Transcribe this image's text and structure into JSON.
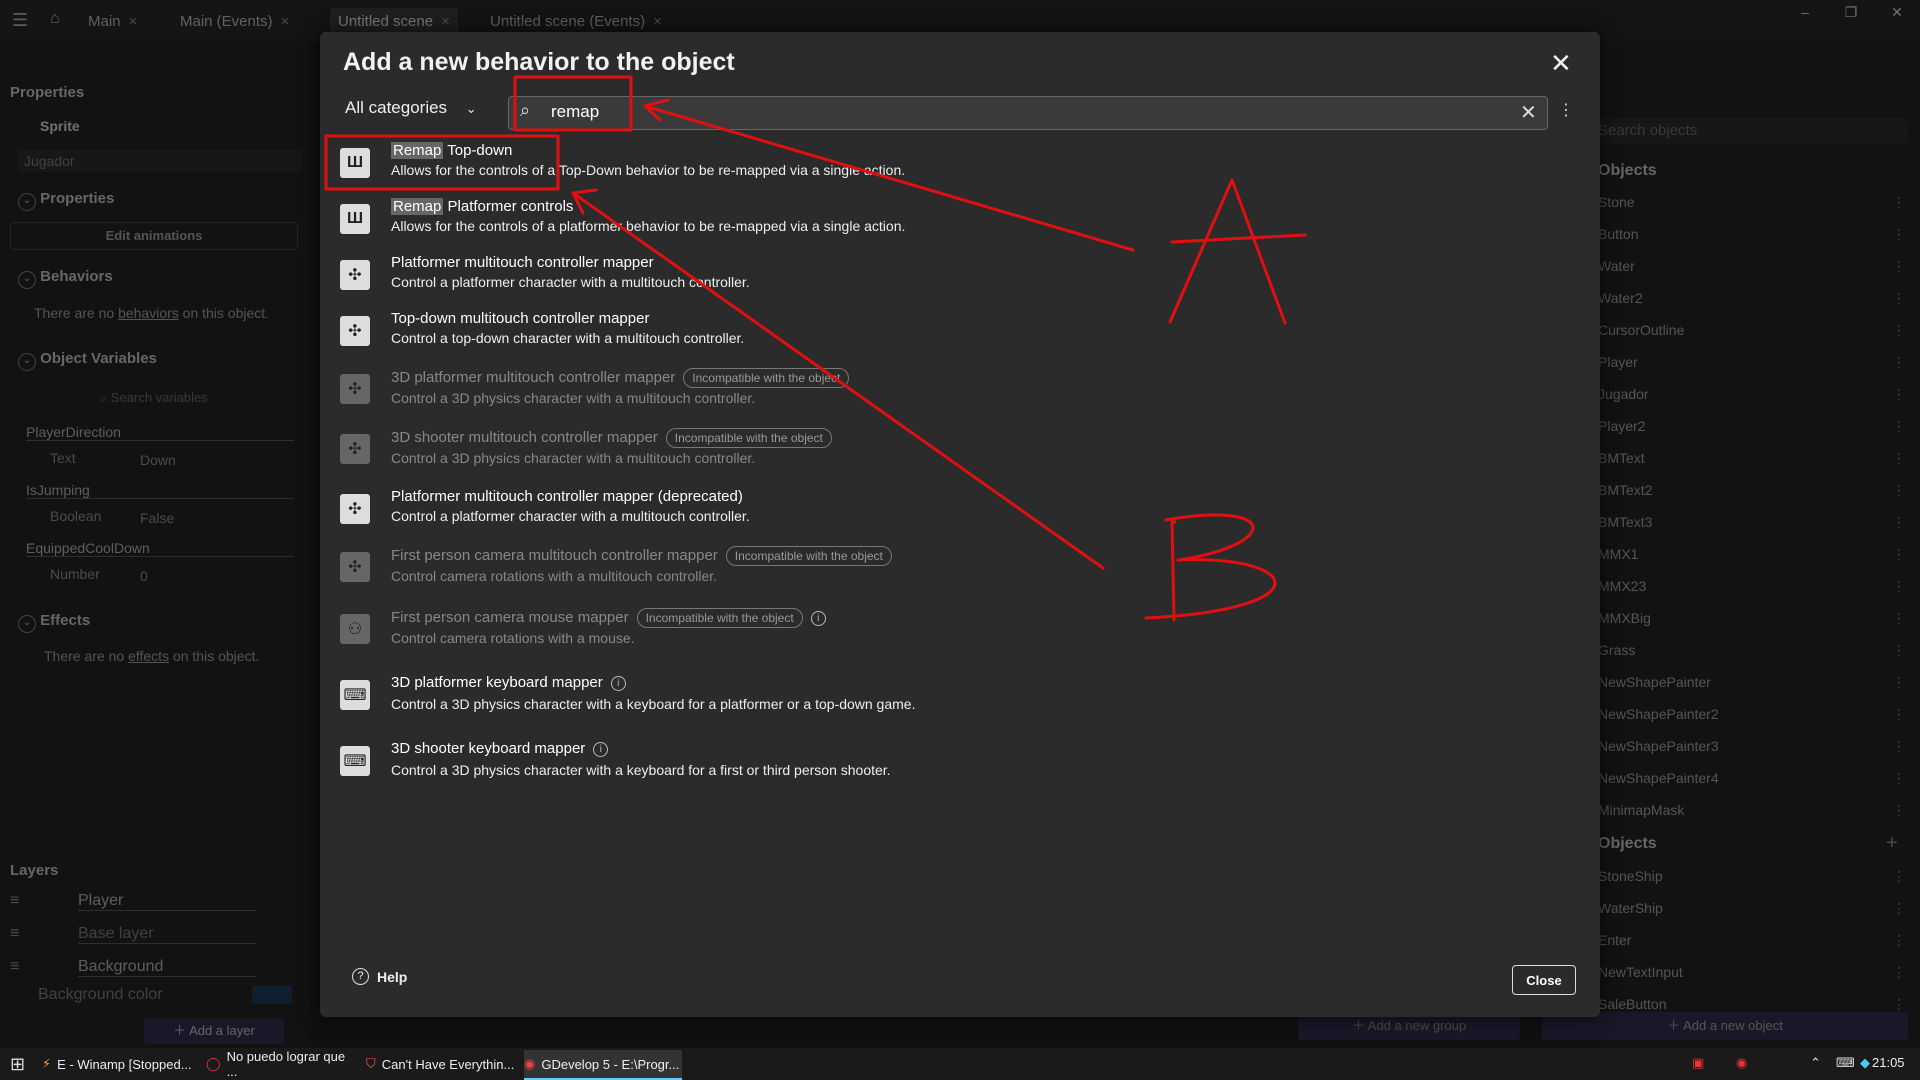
{
  "tabs": [
    {
      "label": "Main"
    },
    {
      "label": "Main (Events)"
    },
    {
      "label": "Untitled scene"
    },
    {
      "label": "Untitled scene (Events)"
    }
  ],
  "left_panel": {
    "properties_title": "Properties",
    "sprite_label": "Sprite",
    "object_name": "Jugador",
    "properties_section": "Properties",
    "edit_animations": "Edit animations",
    "behaviors_section": "Behaviors",
    "behaviors_empty_prefix": "There are no",
    "behaviors_empty_link": "behaviors",
    "behaviors_empty_suffix": "on this object.",
    "variables_section": "Object Variables",
    "search_variables_placeholder": "Search variables",
    "variables": [
      {
        "name": "PlayerDirection",
        "type": "Text",
        "value": "Down"
      },
      {
        "name": "IsJumping",
        "type": "Boolean",
        "value": "False"
      },
      {
        "name": "EquippedCoolDown",
        "type": "Number",
        "value": "0"
      }
    ],
    "effects_section": "Effects",
    "effects_empty_prefix": "There are no",
    "effects_empty_link": "effects",
    "effects_empty_suffix": "on this object.",
    "layers_title": "Layers",
    "layers": [
      {
        "name": "Player"
      },
      {
        "name": "Base layer"
      },
      {
        "name": "Background"
      }
    ],
    "background_color_label": "Background color",
    "add_layer": "Add a layer"
  },
  "right_panel": {
    "search_placeholder": "Search objects",
    "scene_objects_header": "Objects",
    "scene_objects": [
      "Stone",
      "Button",
      "Water",
      "Water2",
      "CursorOutline",
      "Player",
      "Jugador",
      "Player2",
      "BMText",
      "BMText2",
      "BMText3",
      "MMX1",
      "MMX23",
      "MMXBig",
      "Grass",
      "NewShapePainter",
      "NewShapePainter2",
      "NewShapePainter3",
      "NewShapePainter4",
      "MinimapMask"
    ],
    "global_objects_header": "Objects",
    "global_objects": [
      "StoneShip",
      "WaterShip",
      "Enter",
      "NewTextInput",
      "SaleButton"
    ],
    "add_group": "Add a new group",
    "add_object": "Add a new object"
  },
  "dialog": {
    "title": "Add a new behavior to the object",
    "category": "All categories",
    "search_value": "remap",
    "results": [
      {
        "highlight": "Remap",
        "title_rest": " Top-down",
        "desc": "Allows for the controls of a Top-Down behavior to be re-mapped via a single action.",
        "icon": "remap-icon",
        "disabled": false
      },
      {
        "highlight": "Remap",
        "title_rest": " Platformer controls",
        "desc": "Allows for the controls of a platformer behavior to be re-mapped via a single action.",
        "icon": "remap-icon",
        "disabled": false
      },
      {
        "title": "Platformer multitouch controller mapper",
        "desc": "Control a platformer character with a multitouch controller.",
        "icon": "joystick-icon",
        "disabled": false
      },
      {
        "title": "Top-down multitouch controller mapper",
        "desc": "Control a top-down character with a multitouch controller.",
        "icon": "joystick-icon",
        "disabled": false
      },
      {
        "title": "3D platformer multitouch controller mapper",
        "desc": "Control a 3D physics character with a multitouch controller.",
        "icon": "joystick-icon",
        "disabled": true,
        "badge": "Incompatible with the object"
      },
      {
        "title": "3D shooter multitouch controller mapper",
        "desc": "Control a 3D physics character with a multitouch controller.",
        "icon": "joystick-icon",
        "disabled": true,
        "badge": "Incompatible with the object"
      },
      {
        "title": "Platformer multitouch controller mapper (deprecated)",
        "desc": "Control a platformer character with a multitouch controller.",
        "icon": "joystick-icon",
        "disabled": false
      },
      {
        "title": "First person camera multitouch controller mapper",
        "desc": "Control camera rotations with a multitouch controller.",
        "icon": "joystick-icon",
        "disabled": true,
        "badge": "Incompatible with the object"
      },
      {
        "title": "First person camera mouse mapper",
        "desc": "Control camera rotations with a mouse.",
        "icon": "mouse-icon",
        "disabled": true,
        "badge": "Incompatible with the object",
        "info": true
      },
      {
        "title": "3D platformer keyboard mapper",
        "desc": "Control a 3D physics character with a keyboard for a platformer or a top-down game.",
        "icon": "keyboard-icon",
        "disabled": false,
        "info": true
      },
      {
        "title": "3D shooter keyboard mapper",
        "desc": "Control a 3D physics character with a keyboard for a first or third person shooter.",
        "icon": "keyboard-icon",
        "disabled": false,
        "info": true
      }
    ],
    "help_label": "Help",
    "close_label": "Close"
  },
  "taskbar": {
    "items": [
      {
        "label": "E - Winamp [Stopped..."
      },
      {
        "label": "No puedo lograr que ..."
      },
      {
        "label": "Can't Have Everythin..."
      },
      {
        "label": "GDevelop 5 - E:\\Progr..."
      }
    ],
    "time": "21:05"
  },
  "annotations": {
    "letter_a": "A",
    "letter_b": "B",
    "color": "#e01010"
  }
}
